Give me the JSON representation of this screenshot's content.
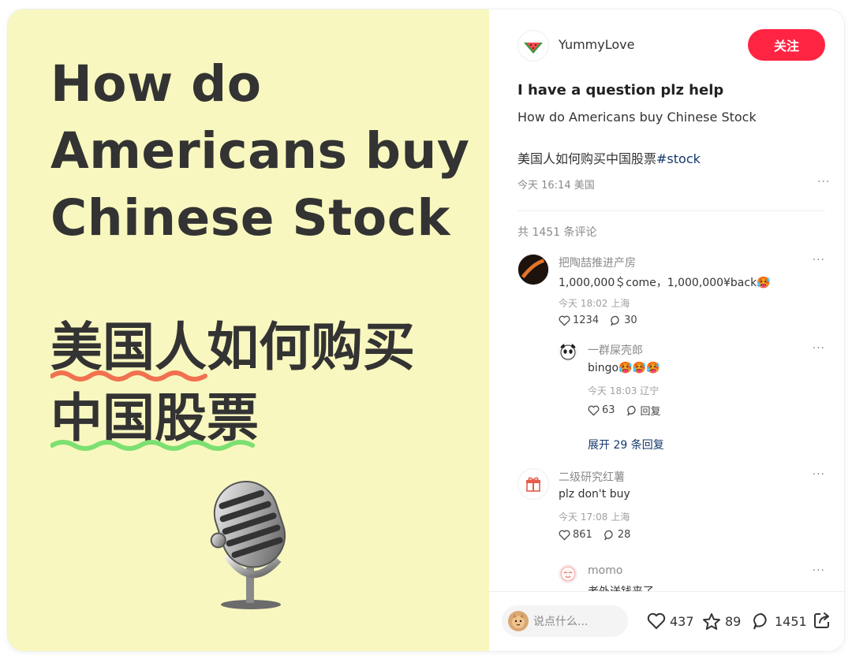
{
  "cover": {
    "title_en": [
      "How do",
      "Americans buy",
      "Chinese Stock"
    ],
    "title_zh": [
      "美国人如何购买",
      "中国股票"
    ],
    "underline_colors": [
      "#f07150",
      "#7ce070"
    ],
    "background": "#f8f7bf"
  },
  "author": {
    "name": "YummyLove",
    "avatar_icon": "watermelon-icon",
    "follow_label": "关注"
  },
  "post": {
    "title": "I have a question plz help",
    "body": "How do Americans buy Chinese Stock",
    "body_zh": "美国人如何购买中国股票",
    "hashtag": "#stock",
    "time": "今天 16:14 美国",
    "more": "···"
  },
  "comments_header": "共 1451 条评论",
  "comments": [
    {
      "name": "把陶喆推进产房",
      "text": "1,000,000＄come，1,000,000¥back🥵",
      "meta": "今天 18:02 上海",
      "likes": "1234",
      "replies": "30"
    },
    {
      "name": "一群屎壳郎",
      "text": "bingo🥵🥵🥵",
      "meta": "今天 18:03 辽宁",
      "likes": "63",
      "reply_label": "回复"
    },
    {
      "expand": "展开 29 条回复"
    },
    {
      "name": "二级研究红薯",
      "text": "plz don't buy",
      "meta": "今天 17:08 上海",
      "likes": "861",
      "replies": "28"
    },
    {
      "name": "momo",
      "text": "老外送钱来了"
    }
  ],
  "bottom": {
    "input_placeholder": "说点什么...",
    "likes": "437",
    "collects": "89",
    "comments": "1451"
  },
  "colors": {
    "accent": "#ff2442",
    "link": "#13386c"
  }
}
